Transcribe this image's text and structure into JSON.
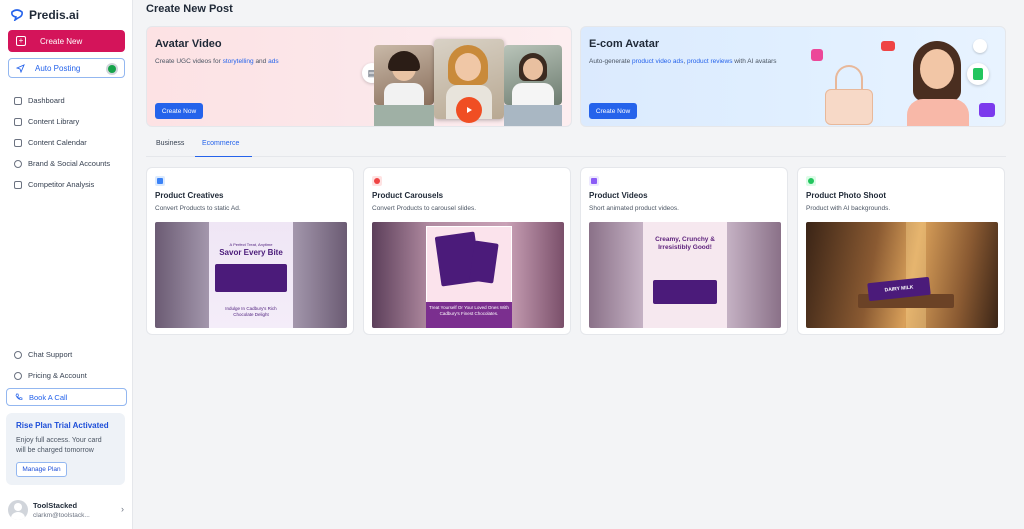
{
  "app": {
    "name": "Predis.ai"
  },
  "sidebar": {
    "create_new": "Create New",
    "auto_posting": "Auto Posting",
    "nav": [
      {
        "label": "Dashboard",
        "icon": "home-icon"
      },
      {
        "label": "Content Library",
        "icon": "library-icon"
      },
      {
        "label": "Content Calendar",
        "icon": "calendar-icon"
      },
      {
        "label": "Brand & Social Accounts",
        "icon": "brand-icon"
      },
      {
        "label": "Competitor Analysis",
        "icon": "chart-icon"
      }
    ],
    "bottom_nav": [
      {
        "label": "Chat Support",
        "icon": "chat-icon"
      },
      {
        "label": "Pricing & Account",
        "icon": "pricing-icon"
      }
    ],
    "book_call": "Book A Call",
    "trial": {
      "title": "Rise Plan Trial Activated",
      "desc_line1": "Enjoy full access. Your card",
      "desc_line2": "will be charged tomorrow",
      "button": "Manage Plan"
    },
    "user": {
      "name": "ToolStacked",
      "email": "clarkm@toolstack..."
    }
  },
  "main": {
    "title": "Create New Post",
    "hero_cards": [
      {
        "title": "Avatar Video",
        "desc_prefix": "Create UGC videos for ",
        "desc_link1": "storytelling",
        "desc_mid": " and ",
        "desc_link2": "ads",
        "desc_suffix": "",
        "button": "Create Now"
      },
      {
        "title": "E-com Avatar",
        "desc_prefix": "Auto-generate ",
        "desc_link1": "product video ads",
        "desc_mid": ", ",
        "desc_link2": "product reviews",
        "desc_suffix": " with AI avatars",
        "button": "Create Now"
      }
    ],
    "tabs": [
      {
        "label": "Business",
        "active": false
      },
      {
        "label": "Ecommerce",
        "active": true
      }
    ],
    "cards": [
      {
        "title": "Product Creatives",
        "desc": "Convert Products to static Ad.",
        "icon_color": "#3b82f6",
        "img_headline": "Savor Every Bite",
        "img_sub": "A Perfect Treat, Anytime",
        "img_footer": "Indulge In Cadbury's Rich Chocolate Delight"
      },
      {
        "title": "Product Carousels",
        "desc": "Convert Products to carousel slides.",
        "icon_color": "#ef4444",
        "img_footer": "Treat Yourself Or Your Loved Ones With Cadbury's Finest Chocolates."
      },
      {
        "title": "Product Videos",
        "desc": "Short animated product videos.",
        "icon_color": "#8b5cf6",
        "img_headline": "Creamy, Crunchy & Irresistibly Good!"
      },
      {
        "title": "Product Photo Shoot",
        "desc": "Product with AI backgrounds.",
        "icon_color": "#22c55e",
        "img_label": "DAIRY MILK"
      }
    ]
  },
  "colors": {
    "brand_pink": "#d4145a",
    "accent_blue": "#2563eb"
  }
}
